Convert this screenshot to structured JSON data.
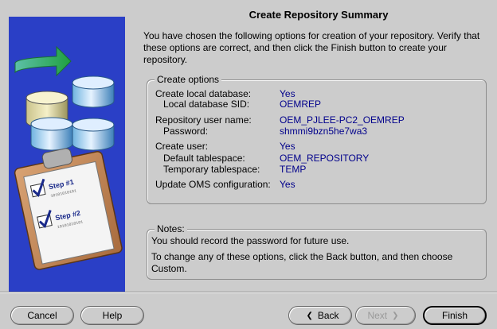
{
  "header": {
    "title": "Create Repository Summary"
  },
  "intro": "You have chosen the following options for creation of your repository.  Verify that these options are correct, and then click the Finish button to create your repository.",
  "options": {
    "legend": "Create options",
    "create_local_db": {
      "label": "Create local database:",
      "value": "Yes"
    },
    "local_sid": {
      "label": "Local database SID:",
      "value": "OEMREP"
    },
    "repo_user": {
      "label": "Repository user name:",
      "value": "OEM_PJLEE-PC2_OEMREP"
    },
    "password": {
      "label": "Password:",
      "value": "shmmi9bzn5he7wa3"
    },
    "create_user": {
      "label": "Create user:",
      "value": "Yes"
    },
    "default_ts": {
      "label": "Default tablespace:",
      "value": "OEM_REPOSITORY"
    },
    "temp_ts": {
      "label": "Temporary tablespace:",
      "value": "TEMP"
    },
    "update_oms": {
      "label": "Update OMS configuration:",
      "value": "Yes"
    }
  },
  "notes": {
    "legend": "Notes:",
    "line1": "You should record the password for future use.",
    "line2": "To change any of these options, click the Back button, and then choose Custom."
  },
  "buttons": {
    "cancel": "Cancel",
    "help": "Help",
    "back": "Back",
    "next": "Next",
    "finish": "Finish"
  },
  "illustration": {
    "step1": "Step #1",
    "step2": "Step #2",
    "binary": "10101010101"
  },
  "colors": {
    "value_text": "#00008b",
    "background": "#cccccc",
    "illustration_bg": "#2a3fc6"
  }
}
